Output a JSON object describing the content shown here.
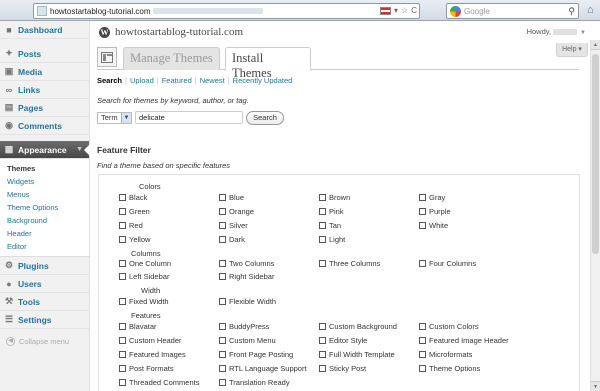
{
  "browser": {
    "url": "howtostartablog-tutorial.com",
    "search_placeholder": "Google",
    "url_star": "☆",
    "url_refresh": "C",
    "url_dropdown": "▾"
  },
  "sidebar": {
    "items": [
      {
        "label": "Dashboard",
        "icon": "dashboard-icon"
      },
      {
        "label": "Posts",
        "icon": "pin-icon"
      },
      {
        "label": "Media",
        "icon": "media-icon"
      },
      {
        "label": "Links",
        "icon": "link-icon"
      },
      {
        "label": "Pages",
        "icon": "pages-icon"
      },
      {
        "label": "Comments",
        "icon": "comments-icon"
      },
      {
        "label": "Appearance",
        "icon": "appearance-icon"
      },
      {
        "label": "Plugins",
        "icon": "plugins-icon"
      },
      {
        "label": "Users",
        "icon": "users-icon"
      },
      {
        "label": "Tools",
        "icon": "tools-icon"
      },
      {
        "label": "Settings",
        "icon": "settings-icon"
      }
    ],
    "appearance_submenu": [
      "Themes",
      "Widgets",
      "Menus",
      "Theme Options",
      "Background",
      "Header",
      "Editor"
    ],
    "collapse_label": "Collapse menu"
  },
  "header": {
    "site_title": "howtostartablog-tutorial.com",
    "howdy": "Howdy,",
    "help": "Help"
  },
  "tabs": {
    "manage": "Manage Themes",
    "install": "Install Themes"
  },
  "subnav": {
    "links": [
      "Search",
      "Upload",
      "Featured",
      "Newest",
      "Recently Updated"
    ]
  },
  "search": {
    "description": "Search for themes by keyword, author, or tag.",
    "term_select": "Term",
    "query": "delicate",
    "button": "Search"
  },
  "feature_filter": {
    "heading": "Feature Filter",
    "description": "Find a theme based on specific features",
    "groups": {
      "colors": {
        "title": "Colors",
        "options": [
          "Black",
          "Blue",
          "Brown",
          "Gray",
          "Green",
          "Orange",
          "Pink",
          "Purple",
          "Red",
          "Silver",
          "Tan",
          "White",
          "Yellow",
          "Dark",
          "Light"
        ]
      },
      "columns": {
        "title": "Columns",
        "options": [
          "One Column",
          "Two Columns",
          "Three Columns",
          "Four Columns",
          "Left Sidebar",
          "Right Sidebar"
        ]
      },
      "width": {
        "title": "Width",
        "options": [
          "Fixed Width",
          "Flexible Width"
        ]
      },
      "features": {
        "title": "Features",
        "options": [
          "Blavatar",
          "BuddyPress",
          "Custom Background",
          "Custom Colors",
          "Custom Header",
          "Custom Menu",
          "Editor Style",
          "Featured Image Header",
          "Featured Images",
          "Front Page Posting",
          "Full Width Template",
          "Microformats",
          "Post Formats",
          "RTL Language Support",
          "Sticky Post",
          "Theme Options",
          "Threaded Comments",
          "Translation Ready"
        ]
      }
    }
  }
}
